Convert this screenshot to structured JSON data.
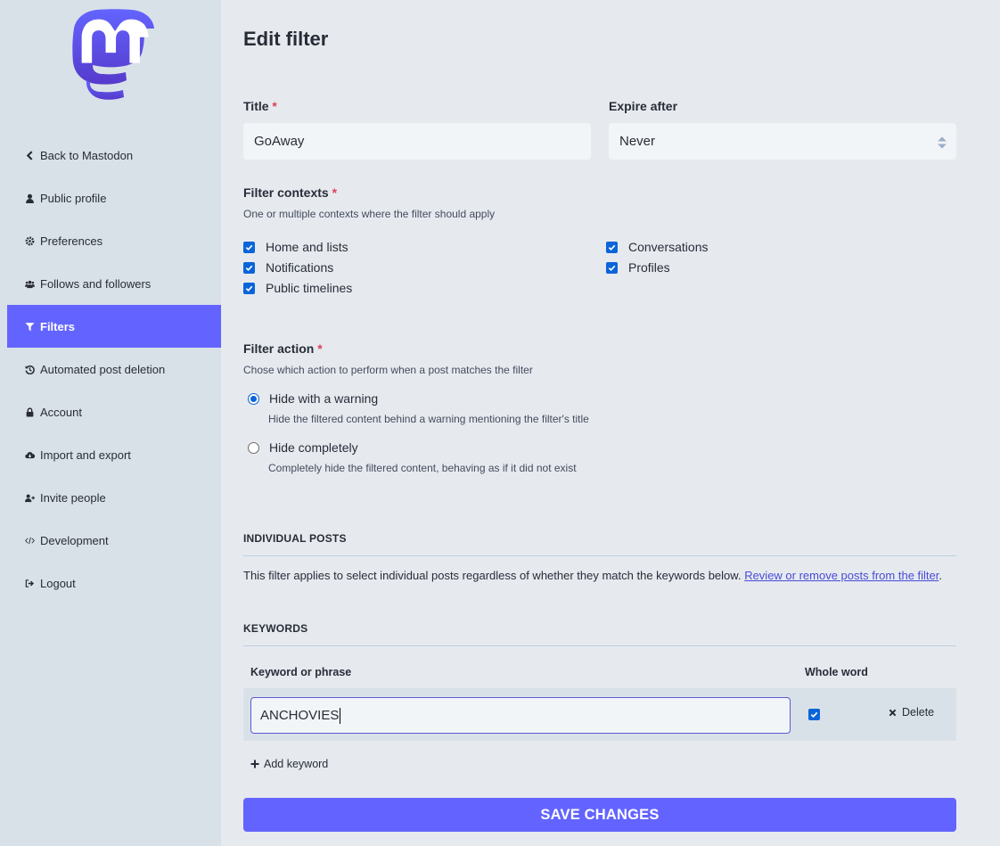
{
  "sidebar": {
    "items": [
      {
        "label": "Back to Mastodon",
        "icon": "chevron-left-icon"
      },
      {
        "label": "Public profile",
        "icon": "user-icon"
      },
      {
        "label": "Preferences",
        "icon": "gear-icon"
      },
      {
        "label": "Follows and followers",
        "icon": "users-icon"
      },
      {
        "label": "Filters",
        "icon": "filter-icon",
        "active": true
      },
      {
        "label": "Automated post deletion",
        "icon": "history-icon"
      },
      {
        "label": "Account",
        "icon": "lock-icon"
      },
      {
        "label": "Import and export",
        "icon": "cloud-download-icon"
      },
      {
        "label": "Invite people",
        "icon": "user-plus-icon"
      },
      {
        "label": "Development",
        "icon": "code-icon"
      },
      {
        "label": "Logout",
        "icon": "sign-out-icon"
      }
    ]
  },
  "page": {
    "title": "Edit filter"
  },
  "form": {
    "title_label": "Title",
    "required_mark": "*",
    "title_value": "GoAway",
    "expire_label": "Expire after",
    "expire_value": "Never",
    "contexts_label": "Filter contexts",
    "contexts_hint": "One or multiple contexts where the filter should apply",
    "contexts": [
      {
        "label": "Home and lists",
        "checked": true
      },
      {
        "label": "Notifications",
        "checked": true
      },
      {
        "label": "Public timelines",
        "checked": true
      },
      {
        "label": "Conversations",
        "checked": true
      },
      {
        "label": "Profiles",
        "checked": true
      }
    ],
    "action_label": "Filter action",
    "action_hint": "Chose which action to perform when a post matches the filter",
    "actions": [
      {
        "label": "Hide with a warning",
        "hint": "Hide the filtered content behind a warning mentioning the filter's title",
        "selected": true
      },
      {
        "label": "Hide completely",
        "hint": "Completely hide the filtered content, behaving as if it did not exist",
        "selected": false
      }
    ]
  },
  "individual_posts": {
    "heading": "INDIVIDUAL POSTS",
    "text": "This filter applies to select individual posts regardless of whether they match the keywords below.",
    "link": "Review or remove posts from the filter",
    "trailing": "."
  },
  "keywords": {
    "heading": "KEYWORDS",
    "col_keyword": "Keyword or phrase",
    "col_whole_word": "Whole word",
    "rows": [
      {
        "keyword": "ANCHOVIES",
        "whole_word": true,
        "delete_label": "Delete"
      }
    ],
    "add_label": "Add keyword"
  },
  "save_label": "SAVE CHANGES",
  "colors": {
    "accent": "#6364ff",
    "checkbox": "#0b64d8",
    "required": "#df405a",
    "sidebar_bg": "#d9e1e8",
    "page_bg": "#e6eaef"
  }
}
